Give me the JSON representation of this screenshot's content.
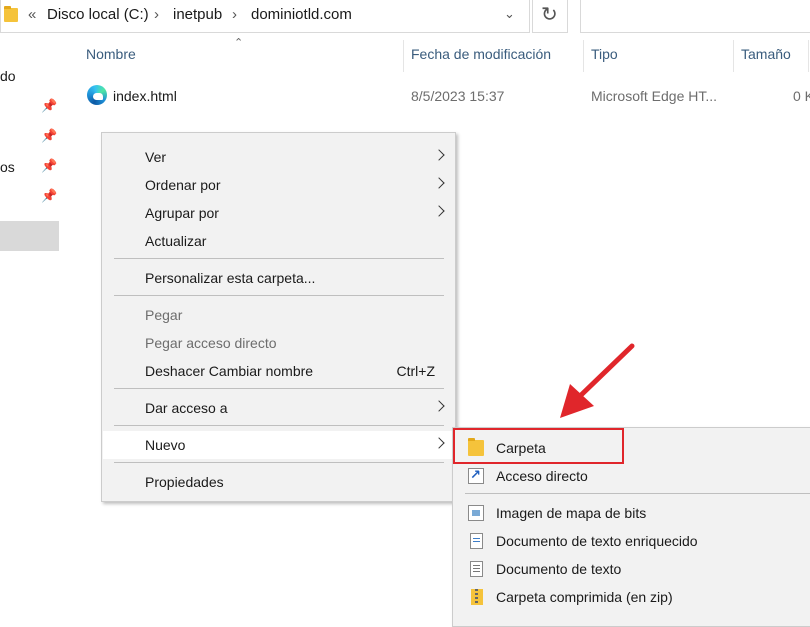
{
  "address_bar": {
    "overflow": "«",
    "crumbs": [
      "Disco local (C:)",
      "inetpub",
      "dominiotld.com"
    ]
  },
  "nav_pane": {
    "fragments": [
      "do",
      "os"
    ]
  },
  "columns": [
    "Nombre",
    "Fecha de modificación",
    "Tipo",
    "Tamaño"
  ],
  "file": {
    "name": "index.html",
    "modified": "8/5/2023 15:37",
    "type": "Microsoft Edge HT...",
    "size": "0 K"
  },
  "context_menu": {
    "items": [
      {
        "label": "Ver"
      },
      {
        "label": "Ordenar por"
      },
      {
        "label": "Agrupar por"
      },
      {
        "label": "Actualizar"
      },
      {
        "label": "Personalizar esta carpeta..."
      },
      {
        "label": "Pegar"
      },
      {
        "label": "Pegar acceso directo"
      },
      {
        "label": "Deshacer Cambiar nombre",
        "shortcut": "Ctrl+Z"
      },
      {
        "label": "Dar acceso a"
      },
      {
        "label": "Nuevo"
      },
      {
        "label": "Propiedades"
      }
    ]
  },
  "submenu": {
    "items": [
      {
        "label": "Carpeta",
        "icon": "folder-icon"
      },
      {
        "label": "Acceso directo",
        "icon": "shortcut-icon"
      },
      {
        "label": "Imagen de mapa de bits",
        "icon": "bitmap-icon"
      },
      {
        "label": "Documento de texto enriquecido",
        "icon": "rich-text-icon"
      },
      {
        "label": "Documento de texto",
        "icon": "text-document-icon"
      },
      {
        "label": "Carpeta comprimida (en zip)",
        "icon": "zip-folder-icon"
      }
    ]
  },
  "colors": {
    "highlight_box": "#e0262b",
    "arrow": "#e0262b",
    "menu_bg": "#f2f2f2",
    "header_text": "#3a5c7d"
  }
}
